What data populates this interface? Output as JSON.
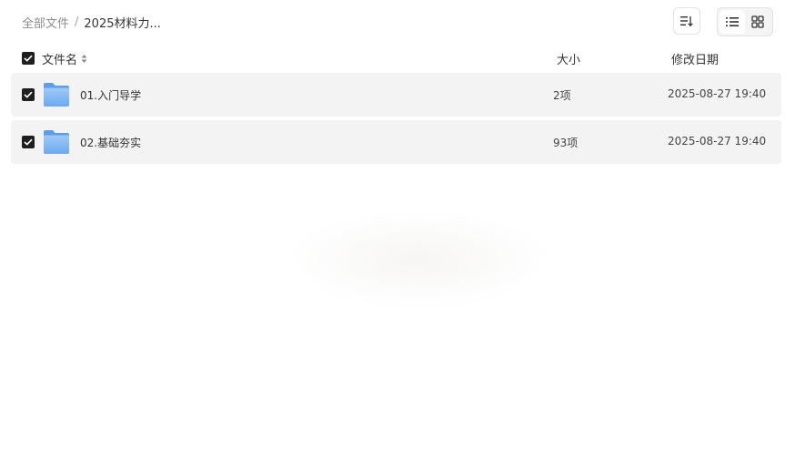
{
  "breadcrumb": {
    "root": "全部文件",
    "separator": "/",
    "current": "2025材料力..."
  },
  "toolbar": {
    "sort_icon": "sort-list-icon",
    "view_list_icon": "list-view-icon",
    "view_grid_icon": "grid-view-icon",
    "active_view": "list"
  },
  "table": {
    "headers": {
      "name": "文件名",
      "size": "大小",
      "date": "修改日期"
    },
    "rows": [
      {
        "name": "01.入门导学",
        "size": "2项",
        "date": "2025-08-27 19:40",
        "checked": true,
        "icon": "folder-icon"
      },
      {
        "name": "02.基础夯实",
        "size": "93项",
        "date": "2025-08-27 19:40",
        "checked": true,
        "icon": "folder-icon"
      }
    ]
  },
  "colors": {
    "row_bg": "#f3f3f3",
    "checkbox": "#1f1f1f",
    "folder": "#7eb6f0"
  }
}
